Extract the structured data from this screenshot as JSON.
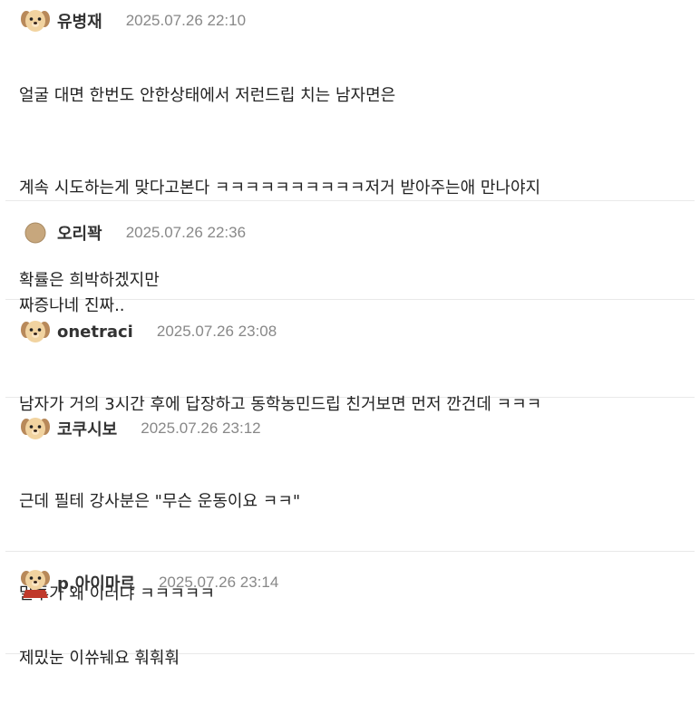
{
  "comments": [
    {
      "nickname": "유병재",
      "date": "2025.07.26 22:10",
      "avatar_icon": "puppy-icon",
      "lines": [
        "얼굴 대면 한번도 안한상태에서 저런드립 치는 남자면은",
        "",
        "계속 시도하는게 맞다고본다 ㅋㅋㅋㅋㅋㅋㅋㅋㅋㅋ저거 받아주는애 만나야지",
        "",
        "확률은 희박하겠지만"
      ]
    },
    {
      "nickname": "오리꽉",
      "date": "2025.07.26 22:36",
      "avatar_icon": "beige-circle-icon",
      "lines": [
        "짜증나네 진짜.."
      ]
    },
    {
      "nickname": "onetraci",
      "date": "2025.07.26 23:08",
      "avatar_icon": "puppy-icon",
      "lines": [
        "남자가 거의 3시간 후에 답장하고 동학농민드립 친거보면 먼저 깐건데 ㅋㅋㅋ"
      ]
    },
    {
      "nickname": "코쿠시보",
      "date": "2025.07.26 23:12",
      "avatar_icon": "puppy-icon",
      "lines": [
        "근데 필테 강사분은 \"무슨 운동이요 ㅋㅋ\"",
        "",
        "말투가 왜 이러냐 ㅋㅋㅋㅋㅋ"
      ]
    },
    {
      "nickname": "p.아이마르",
      "date": "2025.07.26 23:14",
      "avatar_icon": "puppy-red-cape-icon",
      "lines": [
        "제밌눈 이쓔눼요 훠훠훠"
      ]
    }
  ],
  "colors": {
    "nickname": "#333333",
    "date": "#888888",
    "divider": "#e9e9e9",
    "text": "#222222"
  }
}
